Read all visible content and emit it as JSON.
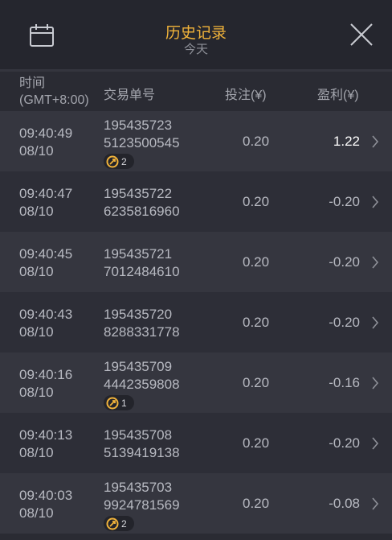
{
  "header": {
    "title": "历史记录",
    "subtitle": "今天",
    "calendar_icon": "calendar-icon",
    "close_icon": "close-icon"
  },
  "columns": {
    "time_line1": "时间",
    "time_line2": "(GMT+8:00)",
    "order": "交易单号",
    "bet": "投注(¥)",
    "profit": "盈利(¥)"
  },
  "rows": [
    {
      "time": "09:40:49",
      "date": "08/10",
      "order1": "195435723",
      "order2": "5123500545",
      "flag_count": "2",
      "bet": "0.20",
      "profit": "1.22"
    },
    {
      "time": "09:40:47",
      "date": "08/10",
      "order1": "195435722",
      "order2": "6235816960",
      "flag_count": null,
      "bet": "0.20",
      "profit": "-0.20"
    },
    {
      "time": "09:40:45",
      "date": "08/10",
      "order1": "195435721",
      "order2": "7012484610",
      "flag_count": null,
      "bet": "0.20",
      "profit": "-0.20"
    },
    {
      "time": "09:40:43",
      "date": "08/10",
      "order1": "195435720",
      "order2": "8288331778",
      "flag_count": null,
      "bet": "0.20",
      "profit": "-0.20"
    },
    {
      "time": "09:40:16",
      "date": "08/10",
      "order1": "195435709",
      "order2": "4442359808",
      "flag_count": "1",
      "bet": "0.20",
      "profit": "-0.16"
    },
    {
      "time": "09:40:13",
      "date": "08/10",
      "order1": "195435708",
      "order2": "5139419138",
      "flag_count": null,
      "bet": "0.20",
      "profit": "-0.20"
    },
    {
      "time": "09:40:03",
      "date": "08/10",
      "order1": "195435703",
      "order2": "9924781569",
      "flag_count": "2",
      "bet": "0.20",
      "profit": "-0.08"
    }
  ],
  "colors": {
    "accent": "#f1b33a",
    "background": "#2a2b33",
    "row_alt": "#35363f",
    "positive": "#ffffff"
  }
}
